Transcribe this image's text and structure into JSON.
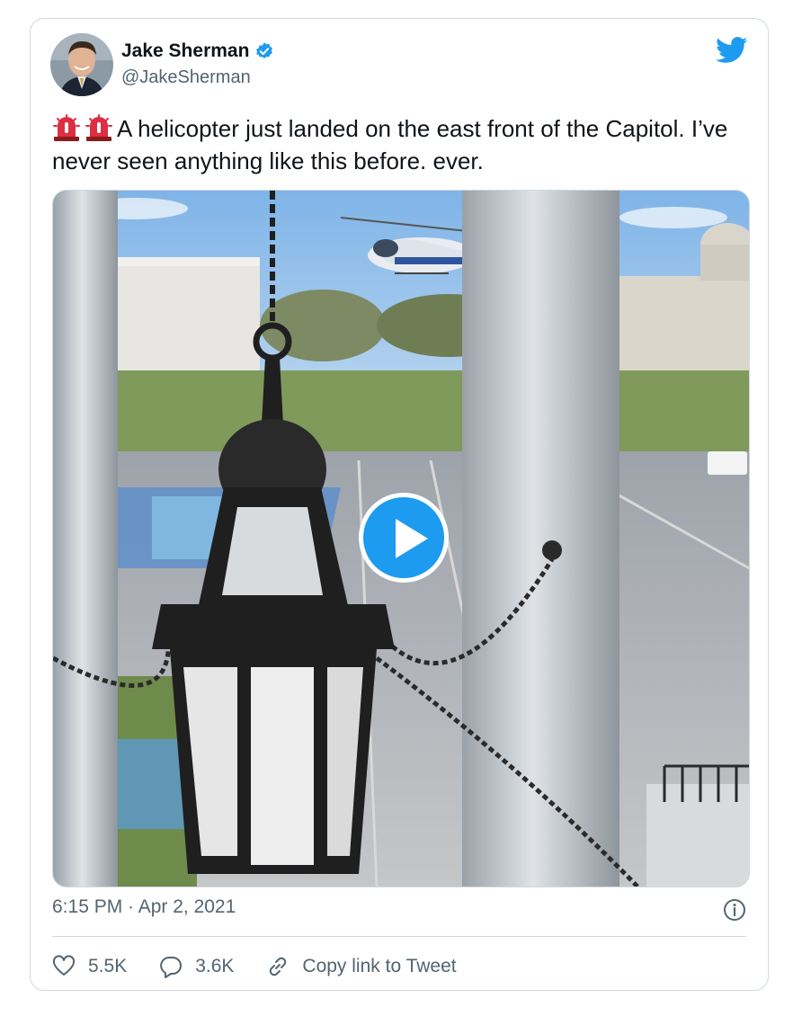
{
  "author": {
    "name": "Jake Sherman",
    "handle": "@JakeSherman",
    "verified": true
  },
  "tweet": {
    "text": "A helicopter just landed on the east front of the Capitol. I’ve never seen anything like this before. ever.",
    "emoji": [
      "rotating-light-emoji",
      "rotating-light-emoji"
    ]
  },
  "media": {
    "type": "video",
    "play_icon": "play-icon"
  },
  "meta": {
    "timestamp": "6:15 PM · Apr 2, 2021"
  },
  "actions": {
    "likes": "5.5K",
    "replies": "3.6K",
    "copy_link": "Copy link to Tweet"
  },
  "colors": {
    "accent": "#1d9bf0",
    "text": "#0f1419",
    "secondary": "#536471",
    "border": "#cfd9de"
  }
}
